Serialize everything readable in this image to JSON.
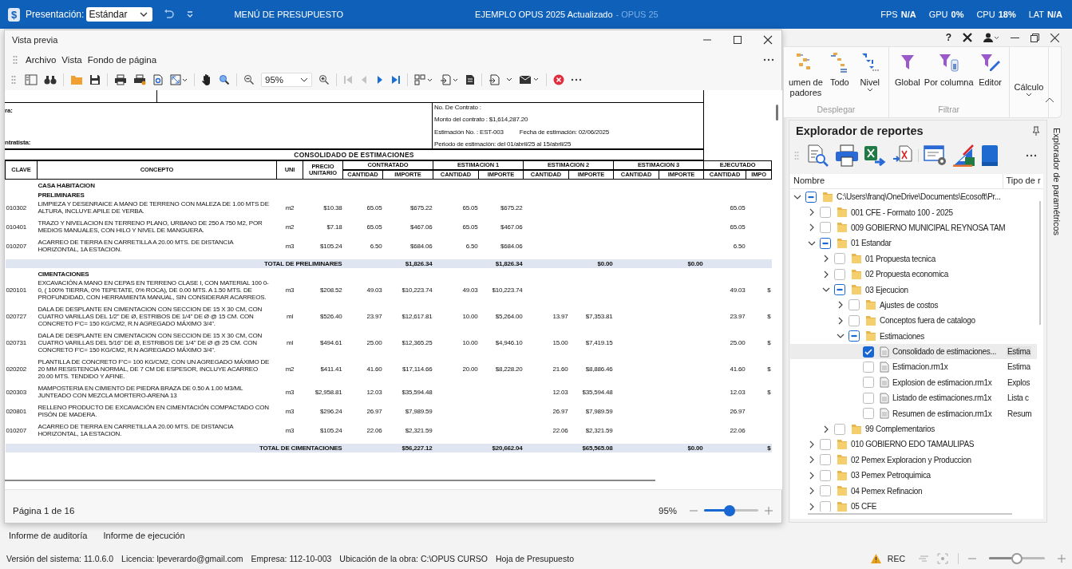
{
  "app_bar": {
    "logo": "$",
    "presentation_label": "Presentación:",
    "presentation_value": "Estándar",
    "menu": "MENÚ DE PRESUPUESTO",
    "title": "EJEMPLO OPUS 2025 Actualizado",
    "title_suffix": "- OPUS 25",
    "stats": [
      {
        "label": "FPS",
        "value": "N/A"
      },
      {
        "label": "GPU",
        "value": "0%"
      },
      {
        "label": "CPU",
        "value": "18%"
      },
      {
        "label": "LAT",
        "value": "N/A"
      }
    ]
  },
  "app_controls": {
    "help": "?"
  },
  "preview": {
    "title": "Vista previa",
    "menu": [
      "Archivo",
      "Vista",
      "Fondo de página"
    ],
    "toolbar": {
      "zoom": "95%",
      "first_page_disabled": true,
      "previous_page_disabled": true
    },
    "document": {
      "left_labels": [
        "ra:",
        "ntratista:"
      ],
      "info": [
        [
          "No. De Contrato :"
        ],
        [
          "Monto del contrato : $1,614,287.20"
        ],
        [
          "Estimación No. : EST-003",
          "Fecha de estimación: 02/06/2025"
        ],
        [
          "Periodo de estimación: del 01/abril/25 al 15/abril/25"
        ]
      ],
      "title": "CONSOLIDADO DE ESTIMACIONES",
      "fixed_headers": [
        "CLAVE",
        "CONCEPTO",
        "UNI",
        "PRECIO UNITARIO"
      ],
      "groups": [
        {
          "label": "CONTRATADO",
          "sub": [
            "CANTIDAD",
            "IMPORTE"
          ]
        },
        {
          "label": "ESTIMACION 1",
          "sub": [
            "CANTIDAD",
            "IMPORTE"
          ]
        },
        {
          "label": "ESTIMACION 2",
          "sub": [
            "CANTIDAD",
            "IMPORTE"
          ]
        },
        {
          "label": "ESTIMACION 3",
          "sub": [
            "CANTIDAD",
            "IMPORTE"
          ]
        },
        {
          "label": "EJECUTADO",
          "sub": [
            "CANTIDAD",
            "IMPO"
          ]
        }
      ],
      "rows": [
        {
          "kind": "section",
          "text": "CASA HABITACION"
        },
        {
          "kind": "section",
          "text": "PRELIMINARES"
        },
        {
          "kind": "item",
          "cells": [
            "010302",
            "LIMPIEZA Y DESENRAICE A MANO DE TERRENO CON MALEZA DE 1.00 MTS DE ALTURA, INCLUYE APILE DE YERBA.",
            "m2",
            "$10.38",
            "65.05",
            "$675.22",
            "65.05",
            "$675.22",
            null,
            null,
            null,
            null,
            "65.05",
            null
          ]
        },
        {
          "kind": "item",
          "cells": [
            "010401",
            "TRAZO Y NIVELACION EN TERRENO PLANO, URBANO DE 250 A 750 M2, POR MEDIOS MANUALES, CON HILO Y NIVEL DE MANGUERA.",
            "m2",
            "$7.18",
            "65.05",
            "$467.06",
            "65.05",
            "$467.06",
            null,
            null,
            null,
            null,
            "65.05",
            null
          ]
        },
        {
          "kind": "item",
          "cells": [
            "010207",
            "ACARREO DE TIERRA EN CARRETILLA A 20.00 MTS. DE DISTANCIA HORIZONTAL, 1A ESTACION.",
            "m3",
            "$105.24",
            "6.50",
            "$684.06",
            "6.50",
            "$684.06",
            null,
            null,
            null,
            null,
            "6.50",
            null
          ]
        },
        {
          "kind": "total",
          "label": "TOTAL DE PRELIMINARES",
          "amounts": [
            "$1,826.34",
            "$1,826.34",
            "$0.00",
            "$0.00"
          ]
        },
        {
          "kind": "section",
          "text": "CIMENTACIONES"
        },
        {
          "kind": "item",
          "cells": [
            "020101",
            "EXCAVACIÓN A MANO EN CEPAS EN TERRENO CLASE I, CON MATERIAL 100 0-0, ( 100% TIERRA, 0% TEPETATE, 0% ROCA), DE 0.00 MTS. A 1.50 MTS. DE PROFUNDIDAD, CON HERRAMIENTA MANUAL, SIN CONSIDERAR ACARREOS.",
            "m3",
            "$208.52",
            "49.03",
            "$10,223.74",
            "49.03",
            "$10,223.74",
            null,
            null,
            null,
            null,
            "49.03",
            "$"
          ]
        },
        {
          "kind": "item",
          "cells": [
            "020727",
            "DALA DE DESPLANTE EN CIMENTACION CON SECCION DE 15 X 30 CM, CON CUATRO VARILLAS DEL 1/2\" DE Ø, ESTRIBOS DE 1/4\" DE Ø @ 15 CM. CON CONCRETO F'C= 150 KG/CM2, R.N AGREGADO MÁXIMO 3/4\".",
            "ml",
            "$526.40",
            "23.97",
            "$12,617.81",
            "10.00",
            "$5,264.00",
            "13.97",
            "$7,353.81",
            null,
            null,
            "23.97",
            "$"
          ]
        },
        {
          "kind": "item",
          "cells": [
            "020731",
            "DALA DE DESPLANTE EN CIMENTACION CON SECCION DE 15 X 30 CM, CON CUATRO VARILLAS DEL 5/16\" DE Ø, ESTRIBOS DE 1/4\" DE Ø @ 25 CM. CON CONCRETO F'C= 150 KG/CM2, R.N AGREGADO MÁXIMO 3/4\".",
            "ml",
            "$494.61",
            "25.00",
            "$12,365.25",
            "10.00",
            "$4,946.10",
            "15.00",
            "$7,419.15",
            null,
            null,
            "25.00",
            "$"
          ]
        },
        {
          "kind": "item",
          "cells": [
            "020202",
            "PLANTILLA DE CONCRETO F'C= 100 KG/CM2, CON UN AGREGADO MÁXIMO DE 20 MM RESISTENCIA NORMAL, DE 7 CM DE ESPESOR, INCLUYE ACARREO 20.00 MTS. TENDIDO Y AFINE.",
            "m2",
            "$411.41",
            "41.60",
            "$17,114.66",
            "20.00",
            "$8,228.20",
            "21.60",
            "$8,886.46",
            null,
            null,
            "41.60",
            "$"
          ]
        },
        {
          "kind": "item",
          "cells": [
            "020303",
            "MAMPOSTERIA EN CIMIENTO DE PIEDRA BRAZA DE 0.50 A 1.00 M3/ML JUNTEADO CON MEZCLA MORTERO-ARENA 13",
            "m3",
            "$2,958.81",
            "12.03",
            "$35,594.48",
            null,
            null,
            "12.03",
            "$35,594.48",
            null,
            null,
            "12.03",
            "$"
          ]
        },
        {
          "kind": "item",
          "cells": [
            "020801",
            "RELLENO PRODUCTO DE EXCAVACIÓN EN CIMENTACIÓN COMPACTADO CON PISÓN DE MADERA.",
            "m3",
            "$296.24",
            "26.97",
            "$7,989.59",
            null,
            null,
            "26.97",
            "$7,989.59",
            null,
            null,
            "26.97",
            null
          ]
        },
        {
          "kind": "item",
          "cells": [
            "010207",
            "ACARREO DE TIERRA EN CARRETILLA A 20.00 MTS. DE DISTANCIA HORIZONTAL, 1A ESTACION.",
            "m3",
            "$105.24",
            "22.06",
            "$2,321.59",
            null,
            null,
            "22.06",
            "$2,321.59",
            null,
            null,
            "22.06",
            null
          ]
        },
        {
          "kind": "total",
          "label": "TOTAL DE CIMENTACIONES",
          "amounts": [
            "$56,227.12",
            "$20,662.04",
            "$65,565.08",
            "$0.00",
            "$"
          ]
        }
      ]
    },
    "status": {
      "page": "Página 1 de 16",
      "zoom": "95%",
      "zoom_slider": {
        "level": 0.47
      }
    }
  },
  "ribbon": {
    "groups": [
      {
        "label": "Desplegar",
        "buttons": [
          {
            "kind": "tiles",
            "lines": [
              "umen de",
              "padores"
            ],
            "dropdown": false
          },
          {
            "kind": "list",
            "lines": [
              "Todo"
            ],
            "dropdown": false
          },
          {
            "kind": "levels",
            "lines": [
              "Nivel"
            ],
            "dropdown": true
          }
        ]
      },
      {
        "label": "Filtrar",
        "buttons": [
          {
            "kind": "funnel",
            "lines": [
              "Global"
            ],
            "dropdown": false
          },
          {
            "kind": "funnel-column",
            "lines": [
              "Por columna"
            ],
            "dropdown": false
          },
          {
            "kind": "funnel-pen",
            "lines": [
              "Editor"
            ],
            "dropdown": false
          }
        ]
      },
      {
        "buttons": [
          {
            "kind": "text",
            "lines": [
              "Cálculo"
            ],
            "dropdown": true
          }
        ]
      }
    ]
  },
  "explorer": {
    "title": "Explorador de reportes",
    "columns": [
      "Nombre",
      "Tipo de r"
    ],
    "tree": [
      {
        "kind": "folder",
        "name": "C:\\Users\\franq\\OneDrive\\Documents\\Ecosoft\\Pr...",
        "expanded": true,
        "checked": false,
        "indeterminate": true,
        "selected": false,
        "children": [
          {
            "kind": "folder",
            "name": "001 CFE - Formato 100 - 2025",
            "expanded": false,
            "checked": false,
            "indeterminate": false,
            "selected": false
          },
          {
            "kind": "folder",
            "name": "009 GOBIERNO MUNICIPAL REYNOSA TAM",
            "expanded": false,
            "checked": false,
            "indeterminate": false,
            "selected": false
          },
          {
            "kind": "folder",
            "name": "01 Estandar",
            "expanded": true,
            "checked": false,
            "indeterminate": true,
            "selected": false,
            "children": [
              {
                "kind": "folder",
                "name": "01 Propuesta tecnica",
                "expanded": false,
                "checked": false,
                "indeterminate": false,
                "selected": false
              },
              {
                "kind": "folder",
                "name": "02 Propuesta economica",
                "expanded": false,
                "checked": false,
                "indeterminate": false,
                "selected": false
              },
              {
                "kind": "folder",
                "name": "03 Ejecucion",
                "expanded": true,
                "checked": false,
                "indeterminate": true,
                "selected": false,
                "children": [
                  {
                    "kind": "folder",
                    "name": "Ajustes de costos",
                    "expanded": false,
                    "checked": false,
                    "indeterminate": false,
                    "selected": false
                  },
                  {
                    "kind": "folder",
                    "name": "Conceptos fuera de catalogo",
                    "expanded": false,
                    "checked": false,
                    "indeterminate": false,
                    "selected": false
                  },
                  {
                    "kind": "folder",
                    "name": "Estimaciones",
                    "expanded": true,
                    "checked": false,
                    "indeterminate": true,
                    "selected": false,
                    "children": [
                      {
                        "kind": "file",
                        "name": "Consolidado de estimaciones...",
                        "type": "Estima",
                        "checked": true,
                        "indeterminate": false,
                        "selected": true
                      },
                      {
                        "kind": "file",
                        "name": "Estimacion.rm1x",
                        "type": "Estima",
                        "checked": false,
                        "indeterminate": false,
                        "selected": false
                      },
                      {
                        "kind": "file",
                        "name": "Explosion de estimacion.rm1x",
                        "type": "Explos",
                        "checked": false,
                        "indeterminate": false,
                        "selected": false
                      },
                      {
                        "kind": "file",
                        "name": "Listado de estimaciones.rm1x",
                        "type": "Lista c",
                        "checked": false,
                        "indeterminate": false,
                        "selected": false
                      },
                      {
                        "kind": "file",
                        "name": "Resumen de estimacion.rm1x",
                        "type": "Resum",
                        "checked": false,
                        "indeterminate": false,
                        "selected": false
                      }
                    ]
                  }
                ]
              },
              {
                "kind": "folder",
                "name": "99 Complementarios",
                "expanded": false,
                "checked": false,
                "indeterminate": false,
                "selected": false
              }
            ]
          },
          {
            "kind": "folder",
            "name": "010 GOBIERNO EDO TAMAULIPAS",
            "expanded": false,
            "checked": false,
            "indeterminate": false,
            "selected": false
          },
          {
            "kind": "folder",
            "name": "02 Pemex Exploracion y Produccion",
            "expanded": false,
            "checked": false,
            "indeterminate": false,
            "selected": false
          },
          {
            "kind": "folder",
            "name": "03 Pemex Petroquimica",
            "expanded": false,
            "checked": false,
            "indeterminate": false,
            "selected": false
          },
          {
            "kind": "folder",
            "name": "04 Pemex Refinacion",
            "expanded": false,
            "checked": false,
            "indeterminate": false,
            "selected": false
          },
          {
            "kind": "folder",
            "name": "05 CFE",
            "expanded": false,
            "checked": false,
            "indeterminate": false,
            "selected": false
          }
        ]
      }
    ]
  },
  "side_tab": "Explorador de paramétricos",
  "bottom_tabs": [
    "Informe de auditoría",
    "Informe de ejecución"
  ],
  "status_bar": {
    "items": [
      "Versión del sistema: 11.0.6.0",
      "Licencia: lpeverardo@gmail.com",
      "Empresa: 112-10-003",
      "Ubicación de la obra: C:\\OPUS CURSO",
      "Hoja de Presupuesto"
    ],
    "rec": "REC",
    "zoom_slider": {
      "level": 0.5
    }
  }
}
